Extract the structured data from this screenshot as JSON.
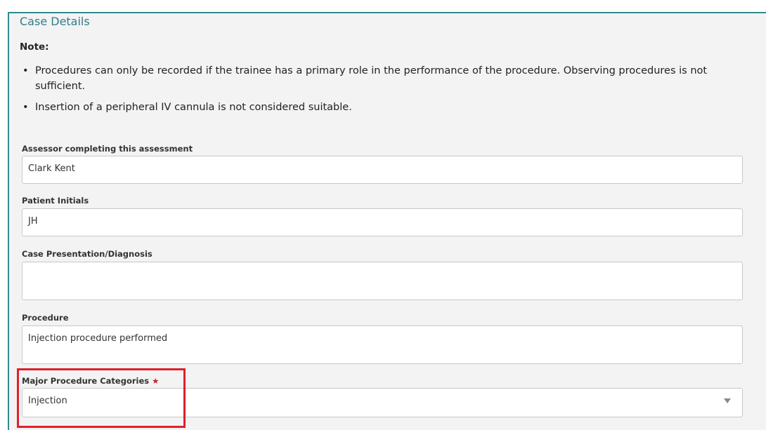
{
  "section": {
    "title": "Case Details",
    "note_label": "Note:",
    "notes": [
      "Procedures can only be recorded if the trainee has a primary role in the performance of the procedure. Observing procedures is not sufficient.",
      "Insertion of a peripheral IV cannula is not considered suitable."
    ]
  },
  "fields": {
    "assessor": {
      "label": "Assessor completing this assessment",
      "value": "Clark Kent"
    },
    "patient_initials": {
      "label": "Patient Initials",
      "value": "JH"
    },
    "case_presentation": {
      "label": "Case Presentation/Diagnosis",
      "value": ""
    },
    "procedure": {
      "label": "Procedure",
      "value": "Injection procedure performed"
    },
    "major_procedure_categories": {
      "label": "Major Procedure Categories",
      "required_marker": "★",
      "value": "Injection"
    }
  },
  "icons": {
    "required": "star-icon",
    "dropdown": "chevron-down-icon"
  },
  "colors": {
    "accent": "#2e7f87",
    "required": "#c0282d",
    "highlight": "#e0202a"
  }
}
